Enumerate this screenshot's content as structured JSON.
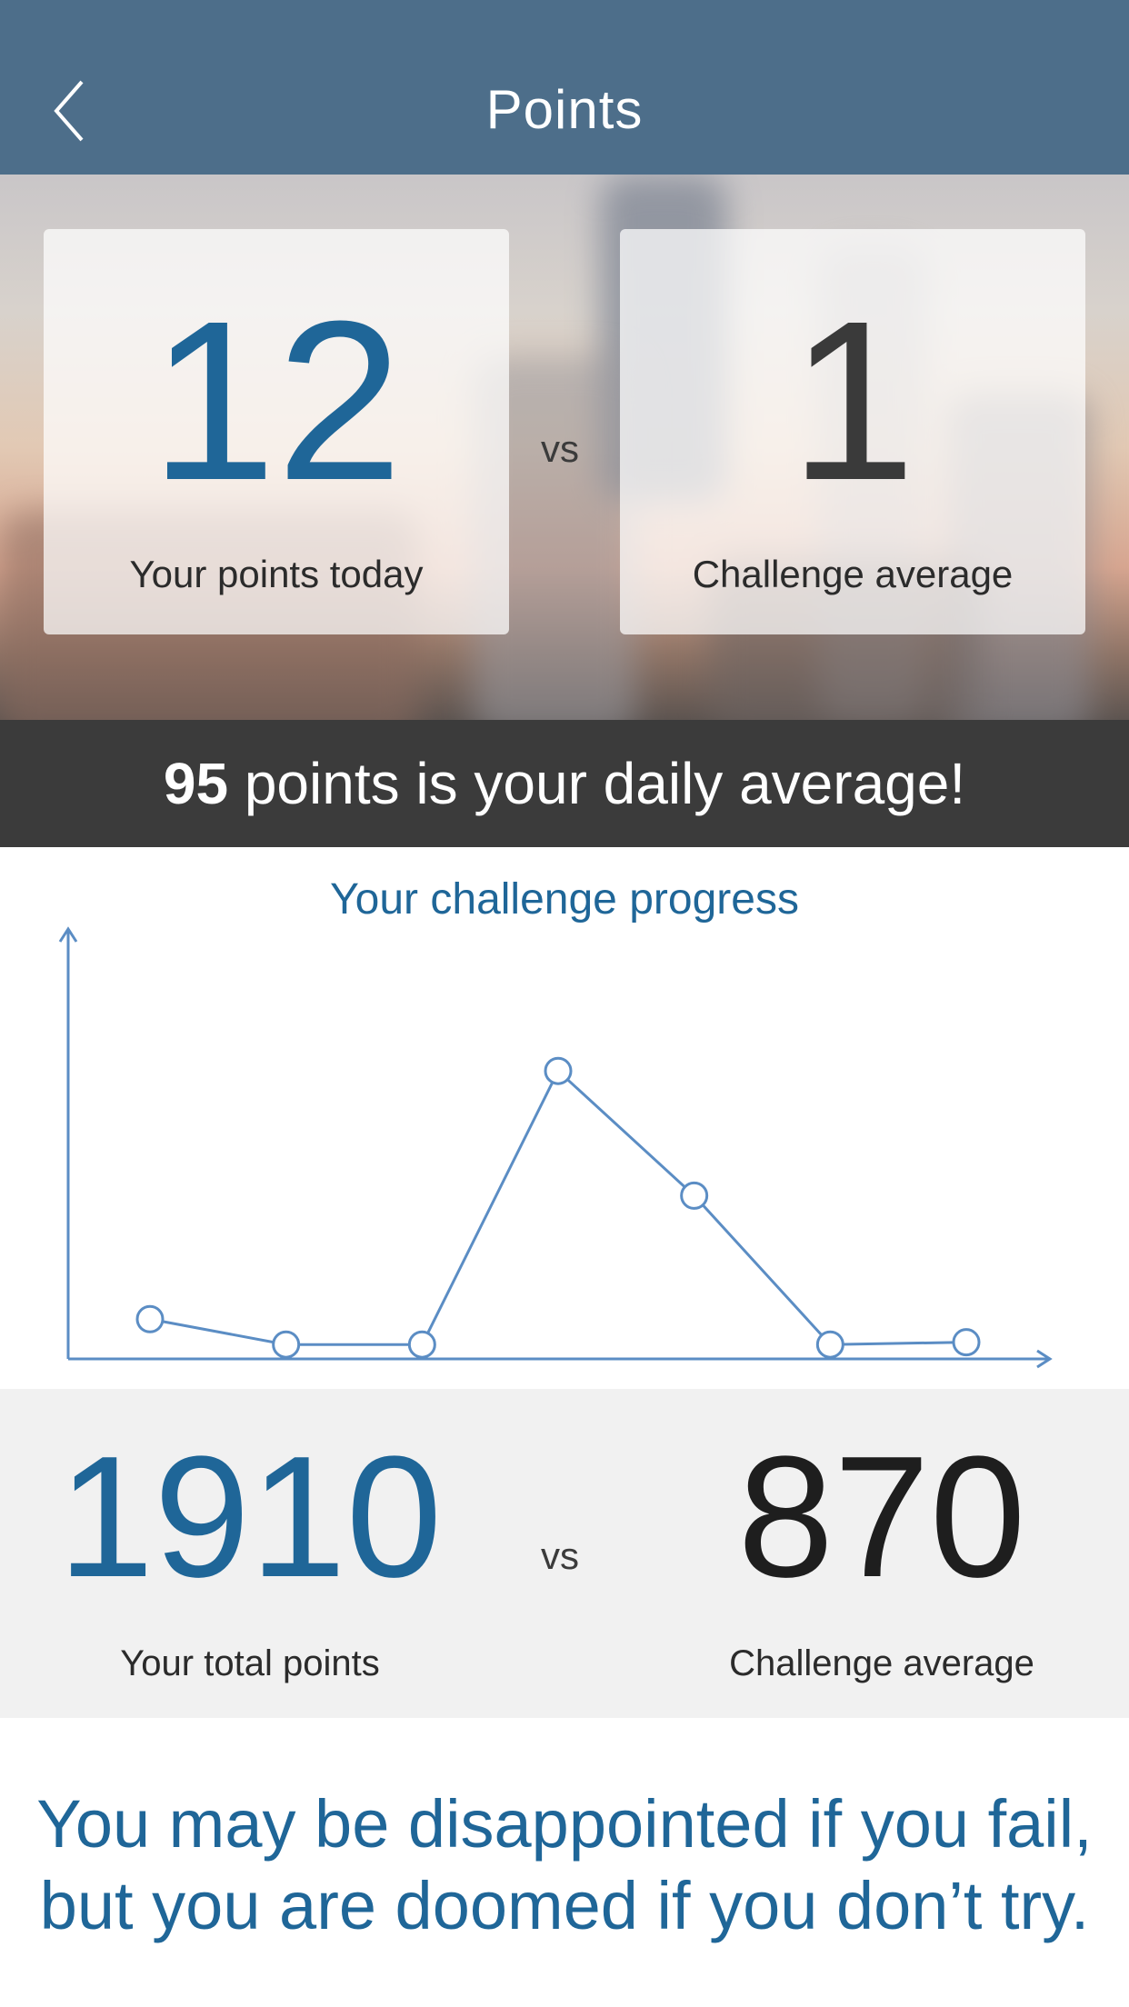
{
  "header": {
    "title": "Points",
    "back_icon": "chevron-left-icon"
  },
  "today": {
    "your_points": "12",
    "your_points_label": "Your points today",
    "vs": "vs",
    "challenge_average": "1",
    "challenge_average_label": "Challenge average"
  },
  "banner": {
    "value": "95",
    "text": " points is your daily average!"
  },
  "chart_data": {
    "type": "line",
    "title": "Your challenge progress",
    "x": [
      1,
      2,
      3,
      4,
      5,
      6,
      7
    ],
    "series": [
      {
        "values": [
          25,
          3,
          3,
          240,
          132,
          3,
          5
        ]
      }
    ],
    "ylim": [
      0,
      300
    ],
    "xlabel": "",
    "ylabel": "",
    "grid": false,
    "line_color": "#5b8dc4"
  },
  "totals": {
    "your_total": "1910",
    "your_total_label": "Your total points",
    "vs": "vs",
    "challenge_average": "870",
    "challenge_average_label": "Challenge average"
  },
  "quote": {
    "line1": "You may be disappointed if you fail,",
    "line2": "but you are doomed if you don’t try."
  },
  "colors": {
    "header": "#4d6e8a",
    "accent_blue": "#1f6698",
    "banner": "#3b3b3b",
    "totals_bg": "#f1f1f1"
  }
}
